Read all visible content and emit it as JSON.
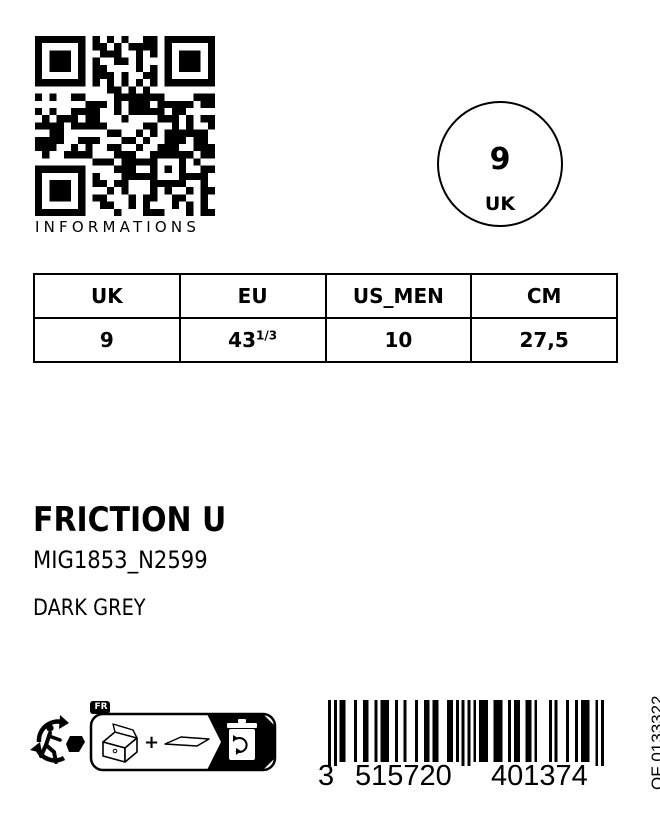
{
  "qr": {
    "caption": "INFORMATIONS"
  },
  "size_badge": {
    "value": "9",
    "unit": "UK"
  },
  "size_table": {
    "headers": [
      "UK",
      "EU",
      "US_MEN",
      "CM"
    ],
    "values": [
      "9",
      "43",
      "10",
      "27,5"
    ],
    "eu_fraction": "1/3"
  },
  "product": {
    "name": "FRICTION U",
    "reference": "MIG1853_N2599",
    "color": "DARK GREY"
  },
  "sorting": {
    "country": "FR",
    "icons": [
      "triman-icon",
      "box-icon",
      "paper-icon",
      "recycle-bin-icon"
    ]
  },
  "barcode": {
    "first_digit": "3",
    "left_group": "515720",
    "right_group": "401374",
    "side_code": "OF 0133322"
  }
}
